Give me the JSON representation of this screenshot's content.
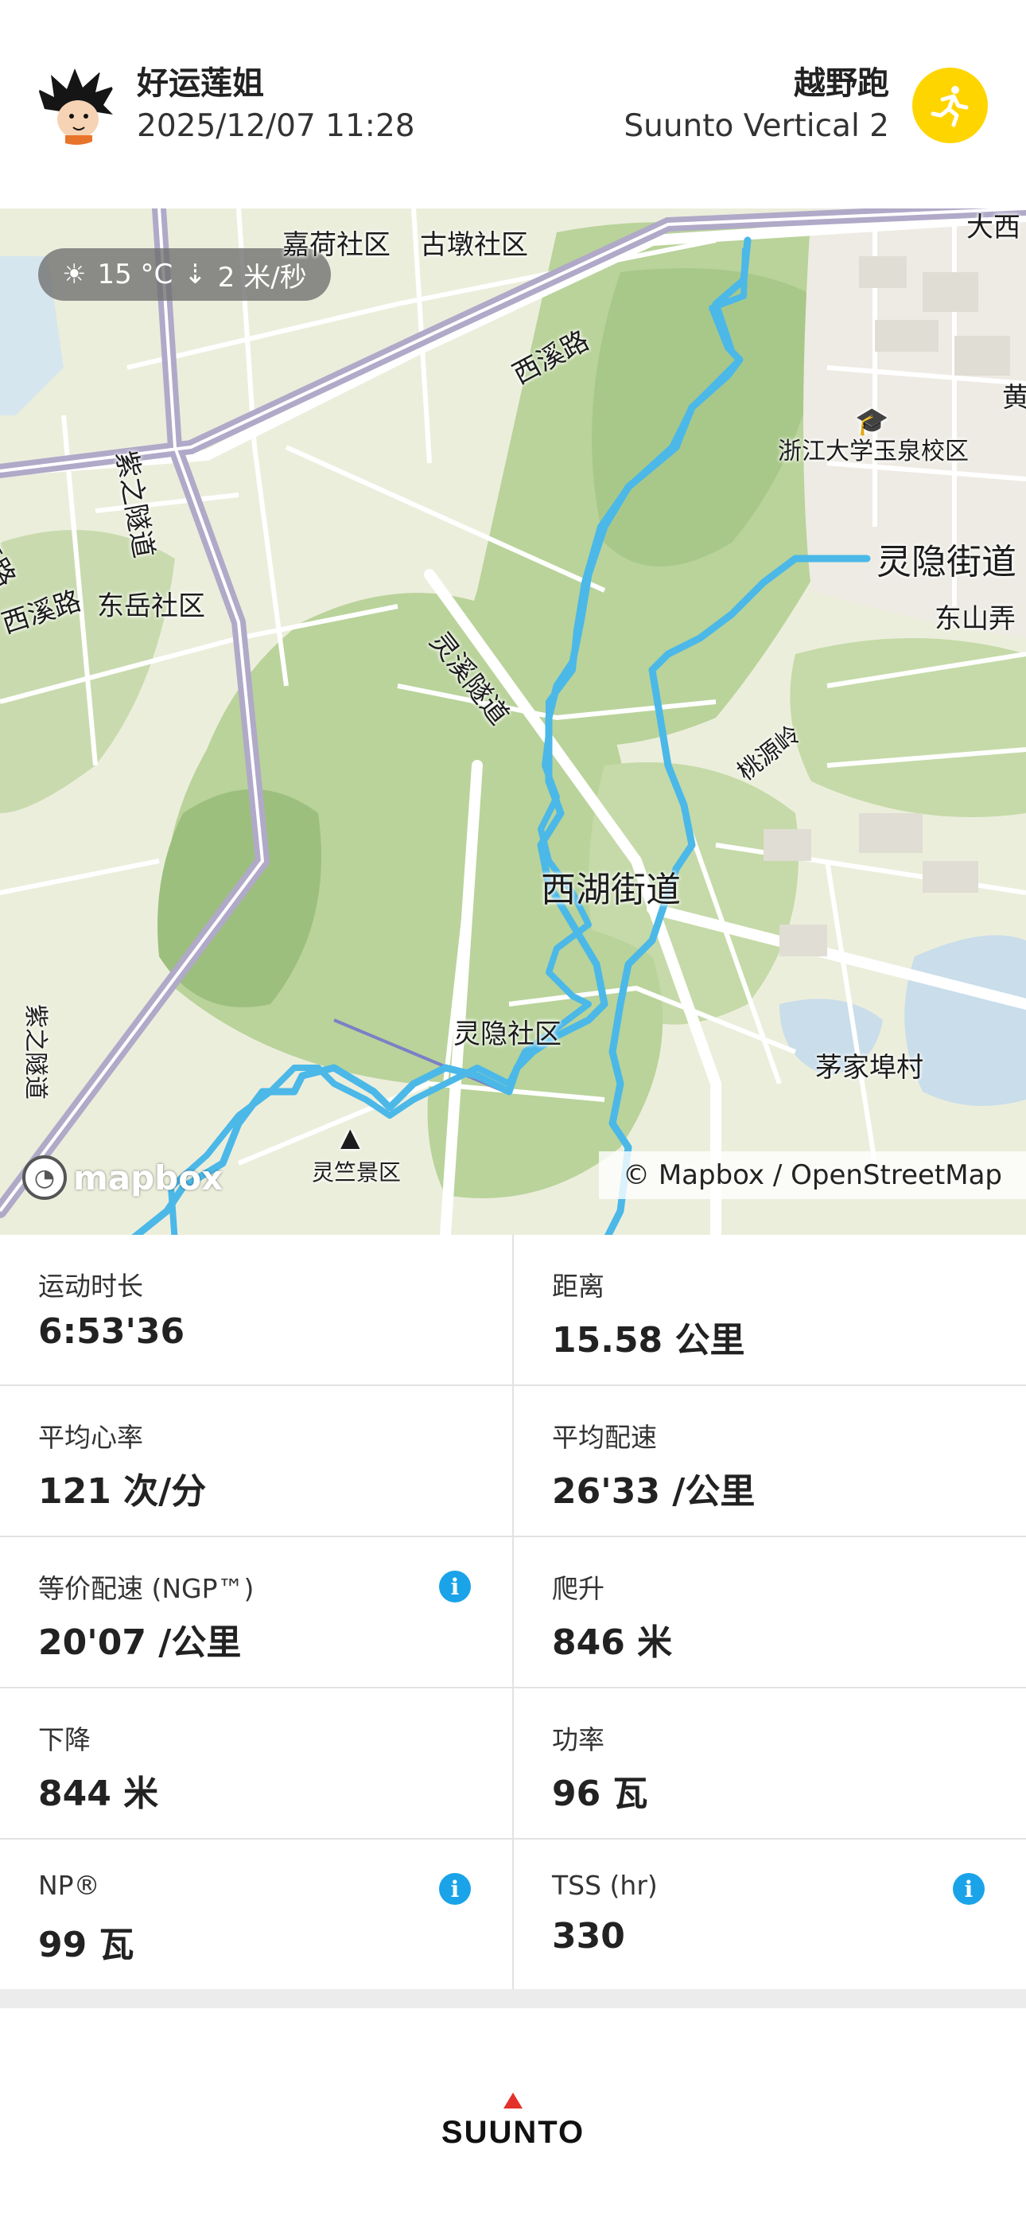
{
  "header": {
    "user_name": "好运莲姐",
    "datetime": "2025/12/07 11:28",
    "sport": "越野跑",
    "device": "Suunto Vertical 2",
    "sport_icon": "trail-running-icon",
    "sport_icon_color": "#FFD500"
  },
  "map": {
    "weather": {
      "temperature": "15 °C",
      "wind": "2 米/秒"
    },
    "labels": {
      "jiahe": "嘉荷社区",
      "gudun": "古墩社区",
      "daxi": "大西",
      "xixi_road_top": "西溪路",
      "zhejiang_univ": "浙江大学玉泉校区",
      "zizhi_tunnel": "紫之隧道",
      "taiwan_road": "泰路",
      "xixi_road_left": "西溪路",
      "dongyue": "东岳社区",
      "lingyin_street": "灵隐街道",
      "dongshan": "东山弄",
      "lingxi_tunnel": "灵溪隧道",
      "taoyuan": "桃源岭",
      "xihu_street": "西湖街道",
      "lingyin_community": "灵隐社区",
      "maojiabu": "茅家埠村",
      "lingzhu": "灵竺景区",
      "zizhi_tunnel_bottom": "紫之隧道",
      "huang": "黄"
    },
    "mapbox": "mapbox",
    "attribution": "© Mapbox / OpenStreetMap",
    "route_color": "#4BB8E8"
  },
  "stats": [
    {
      "label": "运动时长",
      "value": "6:53'36",
      "info": false
    },
    {
      "label": "距离",
      "value": "15.58 公里",
      "info": false
    },
    {
      "label": "平均心率",
      "value": "121 次/分",
      "info": false
    },
    {
      "label": "平均配速",
      "value": "26'33 /公里",
      "info": false
    },
    {
      "label": "等价配速 (NGP™)",
      "value": "20'07 /公里",
      "info": true
    },
    {
      "label": "爬升",
      "value": "846 米",
      "info": false
    },
    {
      "label": "下降",
      "value": "844 米",
      "info": false
    },
    {
      "label": "功率",
      "value": "96 瓦",
      "info": false
    },
    {
      "label": "NP®",
      "value": "99 瓦",
      "info": true
    },
    {
      "label": "TSS (hr)",
      "value": "330",
      "info": true
    }
  ],
  "info_glyph": "i",
  "footer": {
    "brand": "SUUNTO"
  }
}
